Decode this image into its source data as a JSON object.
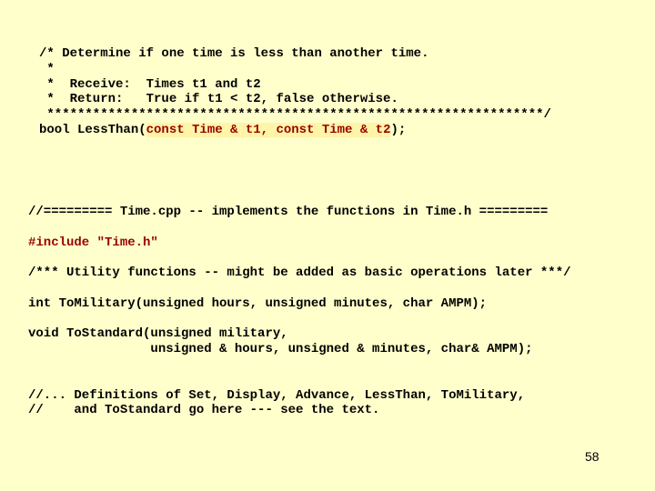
{
  "slide": {
    "page_number": "58",
    "colors": {
      "background": "#FFFFCC",
      "text": "#000000",
      "emphasis_text": "#990000",
      "emphasis_highlight": "#FFF5A8"
    }
  },
  "header_snippet": {
    "comment_lines": [
      "/* Determine if one time is less than another time.",
      " *",
      " *  Receive:  Times t1 and t2",
      " *  Return:   True if t1 < t2, false otherwise.",
      " *****************************************************************/"
    ],
    "prototype": {
      "prefix": "bool LessThan(",
      "params_highlighted": "const Time & t1, const Time & t2",
      "suffix": ");"
    }
  },
  "implementation_snippet": {
    "file_banner": "//========= Time.cpp -- implements the functions in Time.h =========",
    "include_line": "#include \"Time.h\"",
    "utility_comment": "/*** Utility functions -- might be added as basic operations later ***/",
    "to_military_proto": "int ToMilitary(unsigned hours, unsigned minutes, char AMPM);",
    "to_standard_proto_line1": "void ToStandard(unsigned military,",
    "to_standard_proto_line2": "                unsigned & hours, unsigned & minutes, char& AMPM);",
    "definitions_comment_line1": "//... Definitions of Set, Display, Advance, LessThan, ToMilitary,",
    "definitions_comment_line2": "//    and ToStandard go here --- see the text."
  }
}
